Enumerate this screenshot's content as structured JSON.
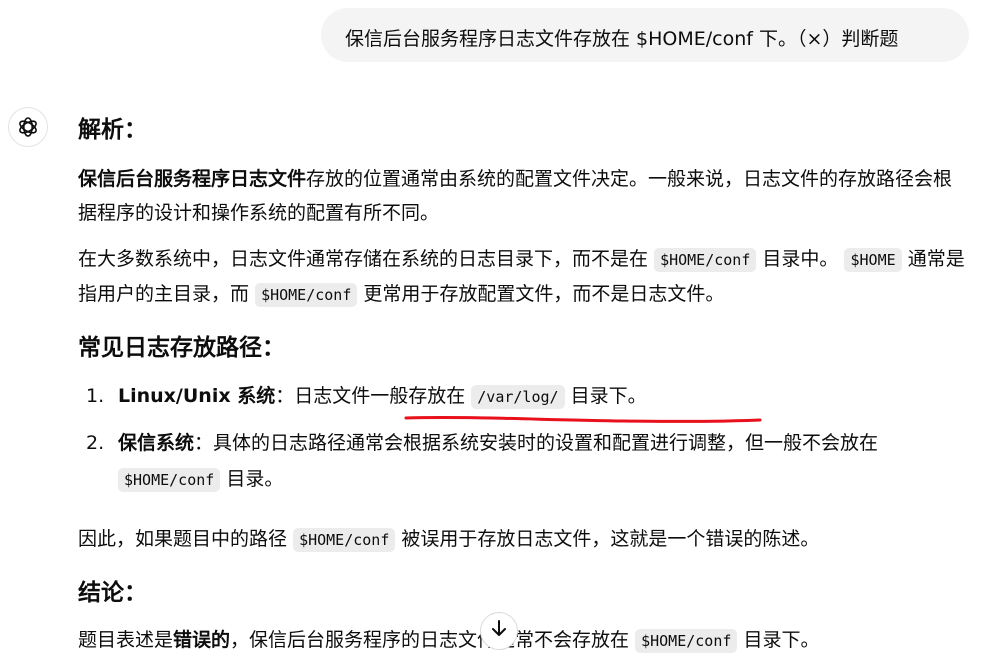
{
  "user_message": {
    "text": "保信后台服务程序日志文件存放在 $HOME/conf 下。（×）判断题"
  },
  "assistant": {
    "analysis_heading": "解析：",
    "para1": {
      "bold": "保信后台服务程序日志文件",
      "rest": "存放的位置通常由系统的配置文件决定。一般来说，日志文件的存放路径会根据程序的设计和操作系统的配置有所不同。"
    },
    "para2": {
      "t1": "在大多数系统中，日志文件通常存储在系统的日志目录下，而不是在",
      "c1": "$HOME/conf",
      "t2": "目录中。",
      "c2": "$HOME",
      "t3": "通常是指用户的主目录，而",
      "c3": "$HOME/conf",
      "t4": "更常用于存放配置文件，而不是日志文件。"
    },
    "paths_heading": "常见日志存放路径：",
    "list": [
      {
        "num": "1.",
        "bold": "Linux/Unix 系统",
        "t1": "：日志文件一般存放在",
        "code": "/var/log/",
        "t2": "目录下。"
      },
      {
        "num": "2.",
        "bold": "保信系统",
        "t1": "：具体的日志路径通常会根据系统安装时的设置和配置进行调整，但一般不会放在",
        "code": "$HOME/conf",
        "t2": "目录。"
      }
    ],
    "para3": {
      "t1": "因此，如果题目中的路径",
      "code": "$HOME/conf",
      "t2": "被误用于存放日志文件，这就是一个错误的陈述。"
    },
    "conclusion_heading": "结论：",
    "para4": {
      "t1": "题目表述是",
      "bold": "错误的",
      "t2": "，保信后台服务程序的日志文件通常不会存放在",
      "code": "$HOME/conf",
      "t3": "目录下。"
    }
  },
  "icons": {
    "avatar": "openai-logo-icon",
    "scroll": "arrow-down-icon"
  },
  "colors": {
    "annotation_underline": "#e8101a",
    "code_bg": "#ececec",
    "user_bubble_bg": "#f4f4f4"
  }
}
